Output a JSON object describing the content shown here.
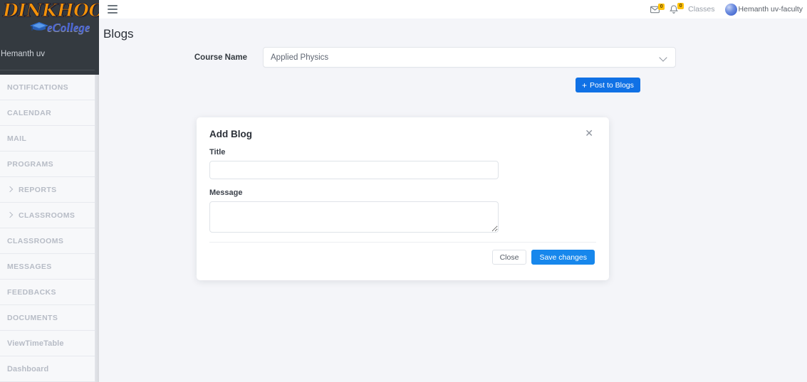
{
  "colors": {
    "accent_blue": "#1071e5",
    "save_blue": "#1787ec",
    "badge_yellow": "#ffc107",
    "sidebar_dark": "#343a40",
    "page_bg": "#f4f5f9",
    "logo_orange": "#f2920a",
    "logo_blue": "#4763d8"
  },
  "sidebar": {
    "logo": {
      "brand": "DINKHOO!",
      "sub_brand": "eCollege",
      "cap_icon": "graduation-cap-icon"
    },
    "username": "Hemanth uv",
    "items": [
      {
        "label": "NOTIFICATIONS",
        "has_chevron": false,
        "style": "upper"
      },
      {
        "label": "CALENDAR",
        "has_chevron": false,
        "style": "upper"
      },
      {
        "label": "MAIL",
        "has_chevron": false,
        "style": "upper"
      },
      {
        "label": "PROGRAMS",
        "has_chevron": false,
        "style": "upper"
      },
      {
        "label": "REPORTS",
        "has_chevron": true,
        "style": "upper"
      },
      {
        "label": "CLASSROOMS",
        "has_chevron": true,
        "style": "upper"
      },
      {
        "label": "CLASSROOMS",
        "has_chevron": false,
        "style": "upper"
      },
      {
        "label": "MESSAGES",
        "has_chevron": false,
        "style": "upper"
      },
      {
        "label": "FEEDBACKS",
        "has_chevron": false,
        "style": "upper"
      },
      {
        "label": "DOCUMENTS",
        "has_chevron": false,
        "style": "upper"
      },
      {
        "label": "ViewTimeTable",
        "has_chevron": false,
        "style": "mixed"
      },
      {
        "label": "Dashboard",
        "has_chevron": false,
        "style": "mixed"
      }
    ]
  },
  "topbar": {
    "menu_icon": "hamburger-icon",
    "mail_icon": "envelope-icon",
    "mail_badge": "0",
    "notification_icon": "bell-icon",
    "notification_badge": "0",
    "classes_label": "Classes",
    "user_name": "Hemanth uv-faculty",
    "avatar_icon": "avatar"
  },
  "main": {
    "page_title": "Blogs",
    "course_label": "Course Name",
    "course_value": "Applied Physics",
    "post_button": "Post to Blogs",
    "post_button_icon": "plus-icon"
  },
  "modal": {
    "title": "Add Blog",
    "close_icon": "close-icon",
    "title_field": {
      "label": "Title",
      "value": "",
      "placeholder": ""
    },
    "message_field": {
      "label": "Message",
      "value": "",
      "placeholder": ""
    },
    "close_button": "Close",
    "save_button": "Save changes"
  }
}
